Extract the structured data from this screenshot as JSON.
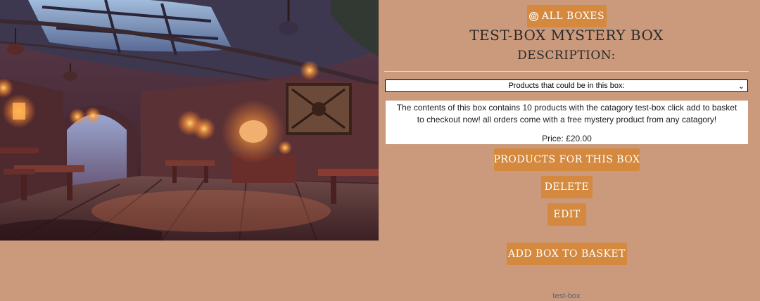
{
  "nav": {
    "all_boxes_label": "ALL BOXES",
    "all_boxes_icon": "dice-icon"
  },
  "box": {
    "title": "TEST-BOX MYSTERY BOX",
    "description_heading": "DESCRIPTION:",
    "products_select": {
      "selected": "Products that could be in this box:"
    },
    "description": "The contents of this box contains 10 products with the catagory test-box click add to basket to checkout now! all orders come with a free mystery product from any catagory!",
    "price": "Price: £20.00",
    "category": "test-box"
  },
  "actions": {
    "products_for_box": "PRODUCTS FOR THIS BOX",
    "delete": "DELETE",
    "edit": "EDIT",
    "add_to_basket": "ADD BOX TO BASKET"
  },
  "colors": {
    "background": "#cb9a7c",
    "button": "#d4893f",
    "button_text": "#ffffff"
  }
}
